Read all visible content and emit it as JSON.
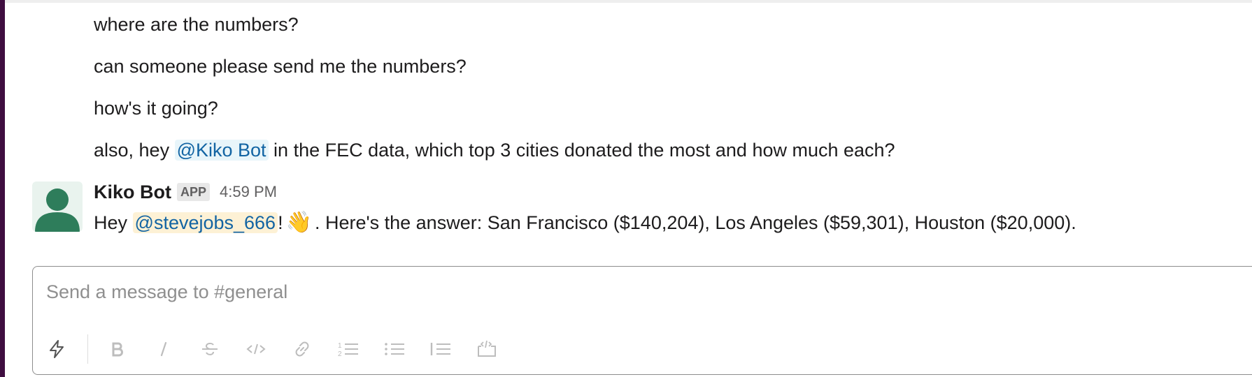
{
  "messages": {
    "line1": "where are the numbers?",
    "line2": "can someone please send me the numbers?",
    "line3": "how's it going?",
    "line4": {
      "prefix": "also, hey ",
      "mention": "@Kiko Bot",
      "suffix": " in the FEC data, which top 3 cities donated the most and how much each?"
    }
  },
  "bot_message": {
    "sender": "Kiko Bot",
    "badge": "APP",
    "time": "4:59 PM",
    "greeting": "Hey ",
    "mention": "@stevejobs_666",
    "exclaim": "!",
    "emoji": "👋",
    "body": ". Here's the answer: San Francisco ($140,204), Los Angeles ($59,301), Houston ($20,000)."
  },
  "composer": {
    "placeholder": "Send a message to #general",
    "toolbar_icons": [
      "lightning-icon",
      "bold-icon",
      "italic-icon",
      "strikethrough-icon",
      "code-icon",
      "link-icon",
      "numbered-list-icon",
      "bulleted-list-icon",
      "blockquote-icon",
      "code-block-icon"
    ]
  },
  "colors": {
    "workspace_rail": "#3f0e40",
    "mention_text": "#1264a3",
    "mention_bg": "#e8f5fa",
    "self_mention_bg": "#fdf1d5",
    "avatar_green": "#2e7d5b"
  }
}
